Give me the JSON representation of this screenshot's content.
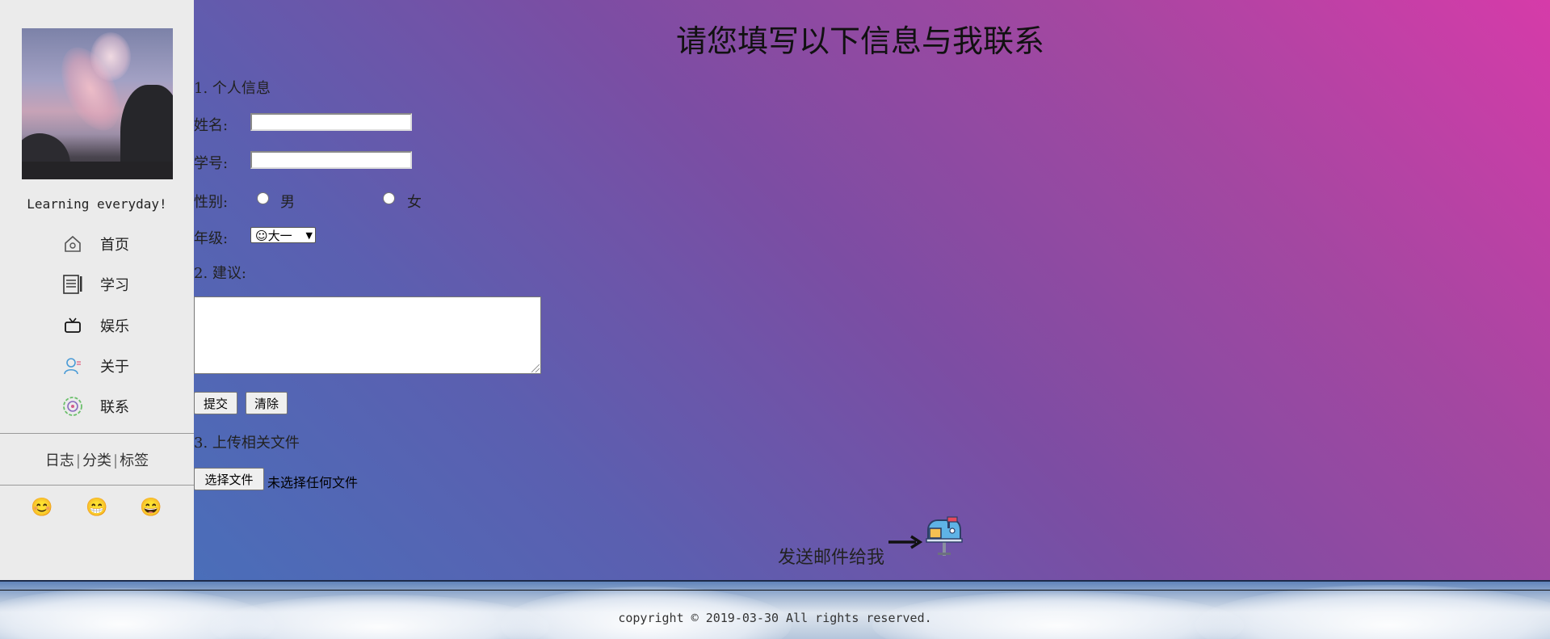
{
  "sidebar": {
    "tagline": "Learning everyday!",
    "nav": [
      {
        "label": "首页",
        "icon": "home-icon"
      },
      {
        "label": "学习",
        "icon": "notebook-icon"
      },
      {
        "label": "娱乐",
        "icon": "tv-icon"
      },
      {
        "label": "关于",
        "icon": "user-icon"
      },
      {
        "label": "联系",
        "icon": "contact-icon"
      }
    ],
    "links": [
      "日志",
      "分类",
      "标签"
    ],
    "link_separator": "|",
    "emojis": [
      "😊",
      "😁",
      "😄"
    ]
  },
  "form": {
    "title": "请您填写以下信息与我联系",
    "section1": "1. 个人信息",
    "name_label": "姓名:",
    "name_value": "",
    "id_label": "学号:",
    "id_value": "",
    "gender_label": "性别:",
    "gender_options": [
      "男",
      "女"
    ],
    "grade_label": "年级:",
    "grade_selected": "☺大一",
    "section2": "2. 建议:",
    "suggestion_value": "",
    "submit_label": "提交",
    "clear_label": "清除",
    "section3": "3. 上传相关文件",
    "file_button_label": "选择文件",
    "file_status": "未选择任何文件",
    "mail_text": "发送邮件给我"
  },
  "footer": {
    "copyright": "copyright © 2019-03-30 All rights reserved."
  },
  "colors": {
    "sidebar_bg": "#ebebeb",
    "gradient_pink": "#d63ba9",
    "gradient_purple": "#7c4da3",
    "gradient_blue": "#4a6eb9"
  }
}
